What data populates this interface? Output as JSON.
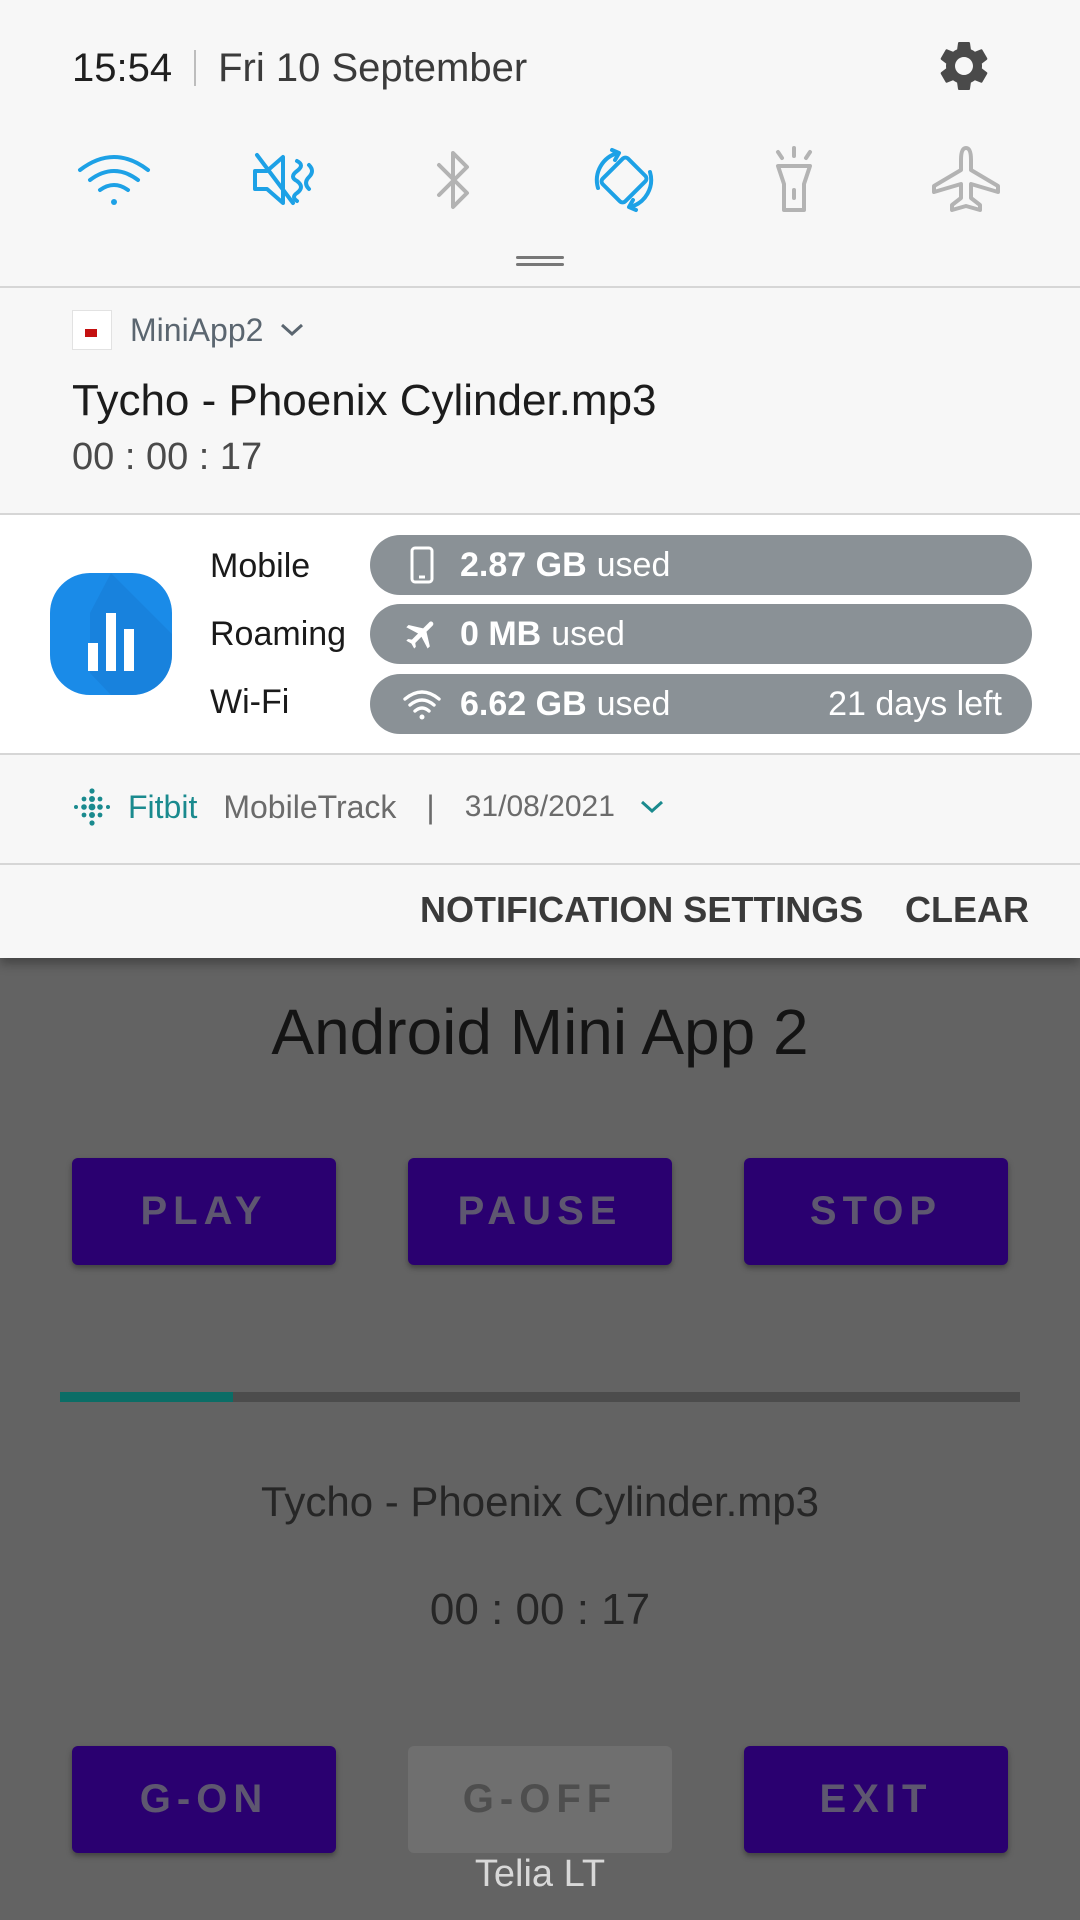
{
  "status_bar": {
    "time": "15:54",
    "date": "Fri 10 September"
  },
  "quick_settings": [
    {
      "name": "wifi",
      "active": true
    },
    {
      "name": "mute",
      "active": true
    },
    {
      "name": "bluetooth",
      "active": false
    },
    {
      "name": "auto-rotate",
      "active": true
    },
    {
      "name": "flashlight",
      "active": false
    },
    {
      "name": "airplane-mode",
      "active": false
    }
  ],
  "media_notification": {
    "app_name": "MiniApp2",
    "title": "Tycho - Phoenix Cylinder.mp3",
    "elapsed": "00 : 00 : 17"
  },
  "data_usage": {
    "rows": [
      {
        "label": "Mobile",
        "icon": "phone-icon",
        "amount": "2.87 GB",
        "suffix": "used",
        "extra": ""
      },
      {
        "label": "Roaming",
        "icon": "airplane-icon",
        "amount": "0 MB",
        "suffix": "used",
        "extra": ""
      },
      {
        "label": "Wi-Fi",
        "icon": "wifi-icon",
        "amount": "6.62 GB",
        "suffix": "used",
        "extra": "21 days left"
      }
    ]
  },
  "fitbit_notification": {
    "app_name": "Fitbit",
    "subtext": "MobileTrack",
    "separator": "|",
    "date": "31/08/2021"
  },
  "shade_actions": {
    "settings": "NOTIFICATION SETTINGS",
    "clear": "CLEAR"
  },
  "app": {
    "title": "Android Mini App 2",
    "buttons_top": {
      "play": "PLAY",
      "pause": "PAUSE",
      "stop": "STOP"
    },
    "progress_fraction": 0.18,
    "song": "Tycho - Phoenix Cylinder.mp3",
    "time": "00 : 00 : 17",
    "buttons_bottom": {
      "g_on": "G-ON",
      "g_off": "G-OFF",
      "exit": "EXIT"
    },
    "carrier": "Telia LT"
  },
  "colors": {
    "accent_blue": "#1da1e6",
    "inactive_gray": "#b3b3b3",
    "button_purple": "#2a0070",
    "progress_teal": "#0b6d66",
    "fitbit_teal": "#1a8a8e"
  }
}
